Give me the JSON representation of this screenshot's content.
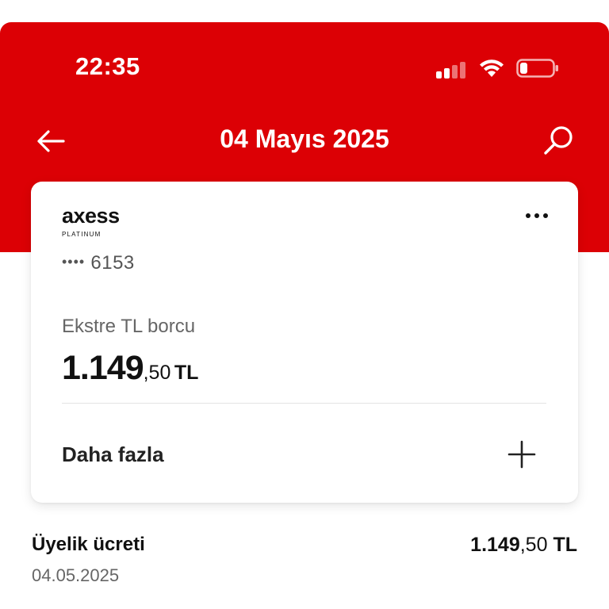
{
  "status_bar": {
    "time": "22:35",
    "icons": [
      "signal-icon",
      "wifi-icon",
      "battery-icon"
    ]
  },
  "header": {
    "back_icon": "arrow-left-icon",
    "title": "04 Mayıs 2025",
    "search_icon": "search-icon",
    "background_color": "#dc0005"
  },
  "card": {
    "brand": "axess",
    "brand_tier": "PLATINUM",
    "masked_dots": "••••",
    "last_digits": "6153",
    "menu_icon": "more-horizontal-icon",
    "statement_label": "Ekstre TL borcu",
    "statement_amount_int": "1.149",
    "statement_amount_frac": ",50",
    "statement_currency": "TL",
    "more_label": "Daha fazla",
    "expand_icon": "plus-icon"
  },
  "transactions": [
    {
      "title": "Üyelik ücreti",
      "date": "04.05.2025",
      "amount_int": "1.149",
      "amount_frac": ",50",
      "currency": "TL"
    }
  ]
}
